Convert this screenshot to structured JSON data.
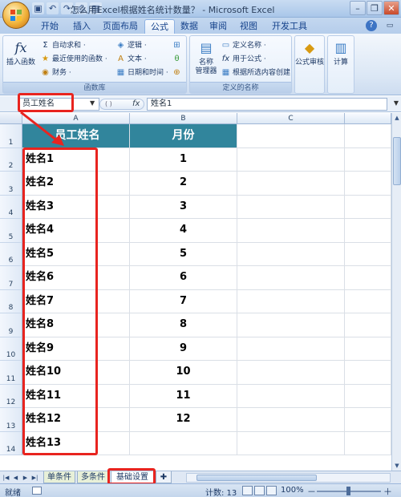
{
  "titlebar": {
    "title": "怎么用Excel根据姓名统计数量？ - Microsoft Excel",
    "qat_icons": [
      "save-icon",
      "undo-icon",
      "redo-icon",
      "print-preview-icon",
      "open-icon"
    ],
    "win_minimize": "–",
    "win_restore": "❐",
    "win_close": "✕"
  },
  "tabs": [
    "开始",
    "插入",
    "页面布局",
    "公式",
    "数据",
    "审阅",
    "视图",
    "开发工具"
  ],
  "active_tab": "公式",
  "ribbon": {
    "insert_function": "插入函数",
    "autosum": "自动求和 ·",
    "recent": "最近使用的函数 ·",
    "finance": "财务 ·",
    "logic": "逻辑 ·",
    "text": "文本 ·",
    "datetime": "日期和时间 ·",
    "group_function_library": "函数库",
    "name_manager_1": "名称",
    "name_manager_2": "管理器",
    "define_name": "定义名称 ·",
    "use_in_formula": "用于公式 ·",
    "create_from_selection": "根据所选内容创建",
    "group_defined_names": "定义的名称",
    "formula_audit": "公式审核",
    "calculation": "计算"
  },
  "formula_bar": {
    "name_box": "员工姓名",
    "fx": "fx",
    "formula": "姓名1"
  },
  "columns": [
    "A",
    "B",
    "C"
  ],
  "rows": [
    {
      "num": "1",
      "name": "员工姓名",
      "month": "月份"
    },
    {
      "num": "2",
      "name": "姓名1",
      "month": "1"
    },
    {
      "num": "3",
      "name": "姓名2",
      "month": "2"
    },
    {
      "num": "4",
      "name": "姓名3",
      "month": "3"
    },
    {
      "num": "5",
      "name": "姓名4",
      "month": "4"
    },
    {
      "num": "6",
      "name": "姓名5",
      "month": "5"
    },
    {
      "num": "7",
      "name": "姓名6",
      "month": "6"
    },
    {
      "num": "8",
      "name": "姓名7",
      "month": "7"
    },
    {
      "num": "9",
      "name": "姓名8",
      "month": "8"
    },
    {
      "num": "10",
      "name": "姓名9",
      "month": "9"
    },
    {
      "num": "11",
      "name": "姓名10",
      "month": "10"
    },
    {
      "num": "12",
      "name": "姓名11",
      "month": "11"
    },
    {
      "num": "13",
      "name": "姓名12",
      "month": "12"
    },
    {
      "num": "14",
      "name": "姓名13",
      "month": ""
    }
  ],
  "header_fill": "#31859c",
  "highlight_color": "#e8241f",
  "sheets": [
    "单条件",
    "多条件",
    "基础设置"
  ],
  "active_sheet": "基础设置",
  "status": {
    "ready": "就绪",
    "count": "计数: 13",
    "zoom": "100%",
    "zoom_minus": "－",
    "zoom_plus": "＋"
  }
}
